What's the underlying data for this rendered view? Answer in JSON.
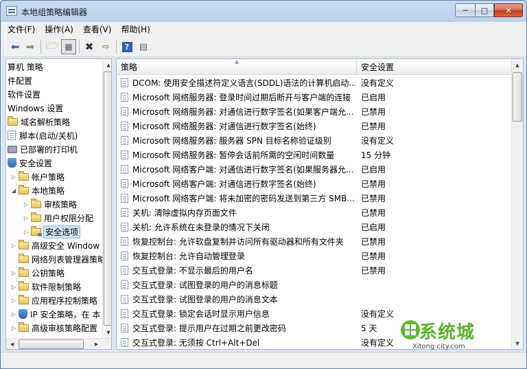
{
  "window": {
    "title": "本地组策略编辑器"
  },
  "menu": [
    "文件(F)",
    "操作(A)",
    "查看(V)",
    "帮助(H)"
  ],
  "toolbar_icons": [
    "back-arrow-icon",
    "forward-arrow-icon",
    "up-folder-icon",
    "show-tree-icon",
    "delete-icon",
    "export-icon",
    "help-icon",
    "properties-icon"
  ],
  "tree": [
    {
      "label": "算机 策略",
      "indent": 0,
      "icon": "none"
    },
    {
      "label": "件配置",
      "indent": 0,
      "icon": "none"
    },
    {
      "label": "软件设置",
      "indent": 0,
      "icon": "none"
    },
    {
      "label": "Windows 设置",
      "indent": 0,
      "icon": "none"
    },
    {
      "label": "域名解析策略",
      "indent": 0,
      "icon": "folder"
    },
    {
      "label": "脚本(启动/关机)",
      "indent": 0,
      "icon": "doc"
    },
    {
      "label": "已部署的打印机",
      "indent": 0,
      "icon": "printer"
    },
    {
      "label": "安全设置",
      "indent": 0,
      "icon": "shield",
      "expanded": true
    },
    {
      "label": "帐户策略",
      "indent": 1,
      "icon": "folder",
      "collapsed": true
    },
    {
      "label": "本地策略",
      "indent": 1,
      "icon": "folder",
      "expanded": true
    },
    {
      "label": "审核策略",
      "indent": 2,
      "icon": "folder",
      "collapsed": true
    },
    {
      "label": "用户权限分配",
      "indent": 2,
      "icon": "folder",
      "collapsed": true
    },
    {
      "label": "安全选项",
      "indent": 2,
      "icon": "folder-lock",
      "collapsed": true,
      "selected": true
    },
    {
      "label": "高级安全 Window",
      "indent": 1,
      "icon": "folder",
      "collapsed": true
    },
    {
      "label": "网络列表管理器策略",
      "indent": 1,
      "icon": "folder"
    },
    {
      "label": "公钥策略",
      "indent": 1,
      "icon": "folder",
      "collapsed": true
    },
    {
      "label": "软件限制策略",
      "indent": 1,
      "icon": "folder",
      "collapsed": true
    },
    {
      "label": "应用程序控制策略",
      "indent": 1,
      "icon": "folder",
      "collapsed": true
    },
    {
      "label": "IP 安全策略，在 本",
      "indent": 1,
      "icon": "shield",
      "collapsed": true
    },
    {
      "label": "高级审核策略配置",
      "indent": 1,
      "icon": "folder",
      "collapsed": true
    }
  ],
  "table": {
    "headers": [
      "策略",
      "安全设置"
    ],
    "rows": [
      [
        "DCOM: 使用安全描述符定义语言(SDDL)语法的计算机启动...",
        "没有定义"
      ],
      [
        "Microsoft 网络服务器: 登录时间过期后断开与客户端的连接",
        "已启用"
      ],
      [
        "Microsoft 网络服务器: 对通信进行数字签名(如果客户端允...",
        "已禁用"
      ],
      [
        "Microsoft 网络服务器: 对通信进行数字签名(始终)",
        "已禁用"
      ],
      [
        "Microsoft 网络服务器: 服务器 SPN 目标名称验证级别",
        "没有定义"
      ],
      [
        "Microsoft 网络服务器: 暂停会话前所需的空闲时间数量",
        "15 分钟"
      ],
      [
        "Microsoft 网络客户端: 对通信进行数字签名(如果服务器允...",
        "已启用"
      ],
      [
        "Microsoft 网络客户端: 对通信进行数字签名(始终)",
        "已禁用"
      ],
      [
        "Microsoft 网络客户端: 将未加密的密码发送到第三方 SMB...",
        "已禁用"
      ],
      [
        "关机: 清除虚拟内存页面文件",
        "已禁用"
      ],
      [
        "关机: 允许系统在未登录的情况下关闭",
        "已启用"
      ],
      [
        "恢复控制台: 允许软盘复制并访问所有驱动器和所有文件夹",
        "已禁用"
      ],
      [
        "恢复控制台: 允许自动管理登录",
        "已禁用"
      ],
      [
        "交互式登录: 不显示最后的用户名",
        "已禁用"
      ],
      [
        "交互式登录: 试图登录的用户的消息标题",
        ""
      ],
      [
        "交互式登录: 试图登录的用户的消息文本",
        ""
      ],
      [
        "交互式登录: 锁定会话时显示用户信息",
        "没有定义"
      ],
      [
        "交互式登录: 提示用户在过期之前更改密码",
        "5 天"
      ],
      [
        "交互式登录: 无须按 Ctrl+Alt+Del",
        "没有定义"
      ]
    ]
  },
  "watermark": {
    "text": "系统城",
    "sub": "Xitong city.com"
  }
}
